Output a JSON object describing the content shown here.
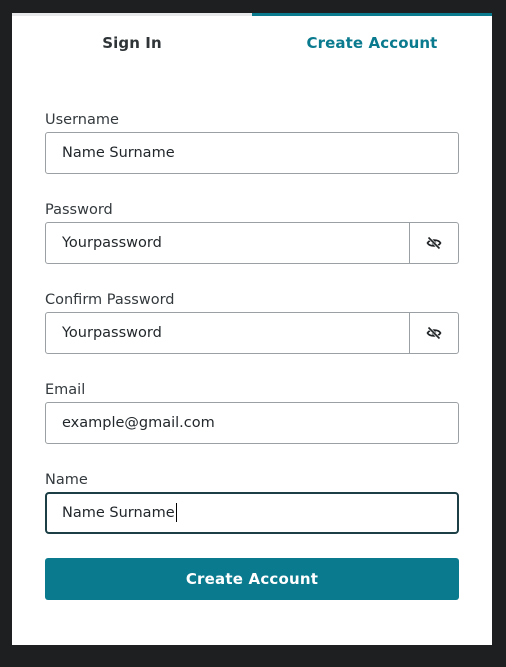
{
  "tabs": {
    "sign_in": "Sign In",
    "create_account": "Create Account",
    "active": "create_account"
  },
  "form": {
    "username": {
      "label": "Username",
      "value": "Name Surname"
    },
    "password": {
      "label": "Password",
      "value": "Yourpassword",
      "toggle_icon": "eye-off-icon"
    },
    "confirm_password": {
      "label": "Confirm Password",
      "value": "Yourpassword",
      "toggle_icon": "eye-off-icon"
    },
    "email": {
      "label": "Email",
      "value": "example@gmail.com"
    },
    "name": {
      "label": "Name",
      "value": "Name Surname",
      "focused": true
    }
  },
  "submit_label": "Create Account",
  "colors": {
    "accent": "#0a7a8e",
    "background": "#1e1f21",
    "card": "#ffffff",
    "focus_border": "#1c3f46"
  }
}
